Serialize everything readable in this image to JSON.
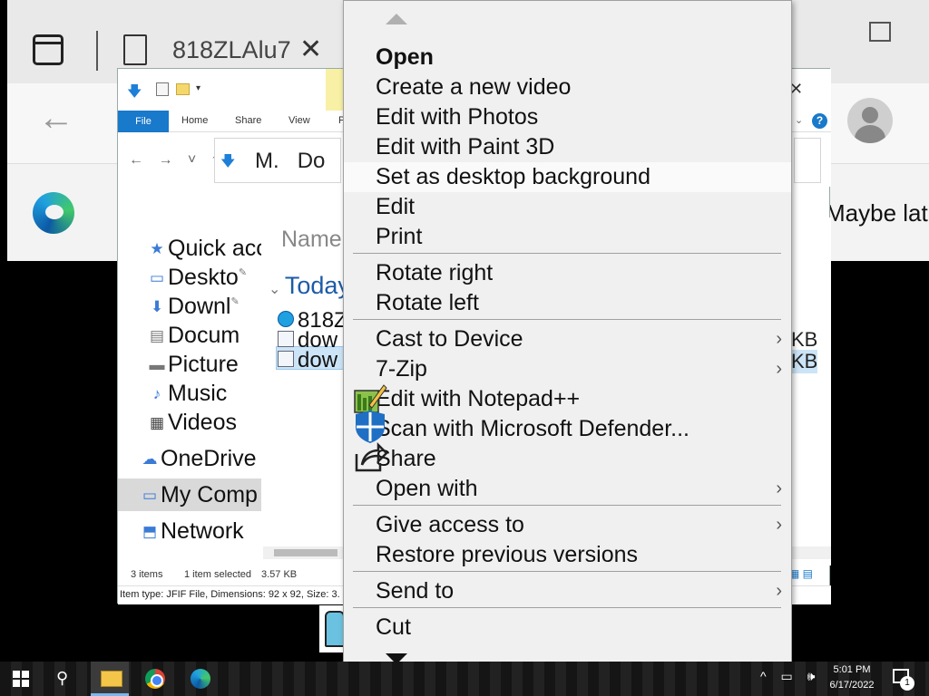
{
  "browser": {
    "tab_title": "818ZLAlu7",
    "tab_close": "✕",
    "notification_text": "Maybe lat"
  },
  "explorer": {
    "ribbon_tabs": [
      "File",
      "Home",
      "Share",
      "View",
      "P"
    ],
    "help": "?",
    "address_text": "M.",
    "address_text2": "Do",
    "nav_items": [
      {
        "label": "Quick acc",
        "icon": "star-icon"
      },
      {
        "label": "Deskto",
        "icon": "desktop-icon"
      },
      {
        "label": "Downl",
        "icon": "download-icon"
      },
      {
        "label": "Docum",
        "icon": "document-icon"
      },
      {
        "label": "Picture",
        "icon": "picture-icon"
      },
      {
        "label": "Music",
        "icon": "music-icon"
      },
      {
        "label": "Videos",
        "icon": "video-icon"
      },
      {
        "label": "OneDrive",
        "icon": "cloud-icon"
      },
      {
        "label": "My Comp",
        "icon": "computer-icon"
      },
      {
        "label": "Network",
        "icon": "network-icon"
      }
    ],
    "column_header": "Name",
    "group_label": "Today",
    "files": [
      "818Z",
      "dow",
      "dow"
    ],
    "right_sizes": [
      "KB",
      "KB"
    ],
    "status_items": "3 items",
    "status_selected": "1 item selected",
    "status_size": "3.57 KB",
    "item_type": "Item type: JFIF File, Dimensions: 92 x 92, Size: 3."
  },
  "context_menu": {
    "items": [
      {
        "label": "Open",
        "bold": true
      },
      {
        "label": "Create a new video"
      },
      {
        "label": "Edit with Photos"
      },
      {
        "label": "Edit with Paint 3D"
      },
      {
        "label": "Set as desktop background",
        "hover": true
      },
      {
        "label": "Edit"
      },
      {
        "label": "Print"
      },
      {
        "label": "Rotate right"
      },
      {
        "label": "Rotate left"
      },
      {
        "label": "Cast to Device",
        "submenu": true
      },
      {
        "label": "7-Zip",
        "submenu": true
      },
      {
        "label": "Edit with Notepad++",
        "icon": "notepad-plus-plus-icon"
      },
      {
        "label": "Scan with Microsoft Defender...",
        "icon": "defender-shield-icon"
      },
      {
        "label": "Share",
        "icon": "share-icon"
      },
      {
        "label": "Open with",
        "submenu": true
      },
      {
        "label": "Give access to",
        "submenu": true
      },
      {
        "label": "Restore previous versions"
      },
      {
        "label": "Send to",
        "submenu": true
      },
      {
        "label": "Cut"
      }
    ],
    "submenu_arrow": "›"
  },
  "taskbar": {
    "time": "5:01 PM",
    "date": "6/17/2022",
    "notification_count": "1",
    "apps": [
      "file-explorer",
      "chrome",
      "edge"
    ]
  },
  "colors": {
    "accent": "#1979ca",
    "menu_bg": "#f0f0f0",
    "selection": "#cce4f7"
  }
}
